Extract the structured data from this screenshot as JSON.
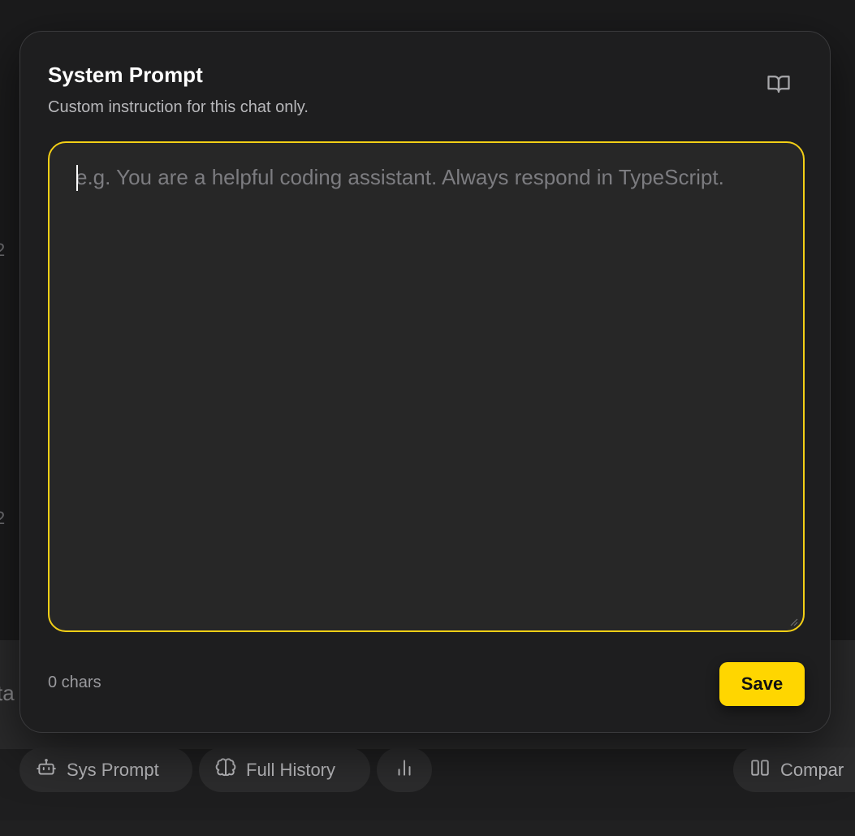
{
  "background": {
    "left_glyph_1": "2",
    "left_glyph_2": "2",
    "bar_text": "ta"
  },
  "modal": {
    "title": "System Prompt",
    "subtitle": "Custom instruction for this chat only.",
    "book_icon": "book-open-icon",
    "prompt": {
      "value": "",
      "placeholder": "e.g. You are a helpful coding assistant. Always respond in TypeScript."
    },
    "char_count": "0 chars",
    "save_label": "Save"
  },
  "toolbar": {
    "sys_prompt_label": "Sys Prompt",
    "full_history_label": "Full History",
    "compare_label": "Compar"
  },
  "colors": {
    "accent": "#ffd600",
    "focus_border": "#f3cf16",
    "modal_bg": "#1e1e1f"
  }
}
